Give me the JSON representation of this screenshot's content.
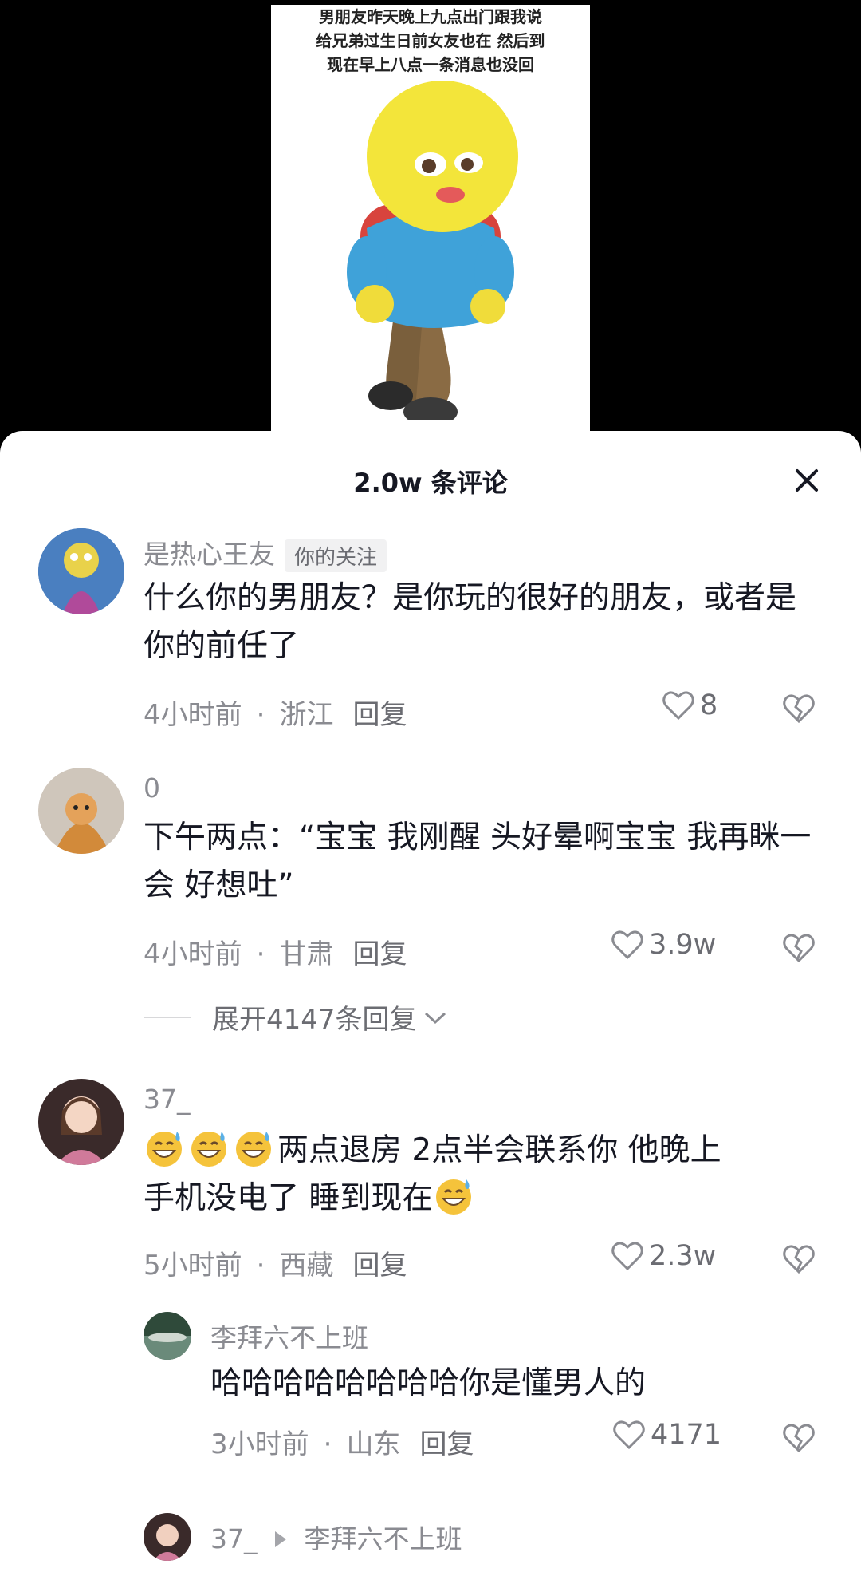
{
  "video": {
    "caption_lines": [
      "男朋友昨天晚上九点出门跟我说",
      "给兄弟过生日前女友也在 然后到",
      "现在早上八点一条消息也没回"
    ]
  },
  "sheet": {
    "title": "2.0w 条评论"
  },
  "comments": [
    {
      "username": "是热心王友",
      "tag": "你的关注",
      "text": "什么你的男朋友？是你玩的很好的朋友，或者是你的前任了",
      "time": "4小时前",
      "location": "浙江",
      "reply_label": "回复",
      "likes": "8"
    },
    {
      "username": "0",
      "text": "下午两点：“宝宝 我刚醒 头好晕啊宝宝 我再眯一会 好想吐”",
      "time": "4小时前",
      "location": "甘肃",
      "reply_label": "回复",
      "likes": "3.9w",
      "expand_label": "展开4147条回复"
    },
    {
      "username": "37_",
      "emoji_name": "sweat-grin-emoji",
      "text_a": "两点退房 2点半会联系你 他晚上",
      "text_b": "手机没电了 睡到现在",
      "time": "5小时前",
      "location": "西藏",
      "reply_label": "回复",
      "likes": "2.3w"
    }
  ],
  "replies": [
    {
      "username": "李拜六不上班",
      "text": "哈哈哈哈哈哈哈哈你是懂男人的",
      "time": "3小时前",
      "location": "山东",
      "reply_label": "回复",
      "likes": "4171"
    },
    {
      "username": "37_",
      "reply_to": "李拜六不上班"
    }
  ],
  "colors": {
    "accent_text": "#161823",
    "muted": "#8a8b91",
    "sheet_bg": "#ffffff"
  }
}
